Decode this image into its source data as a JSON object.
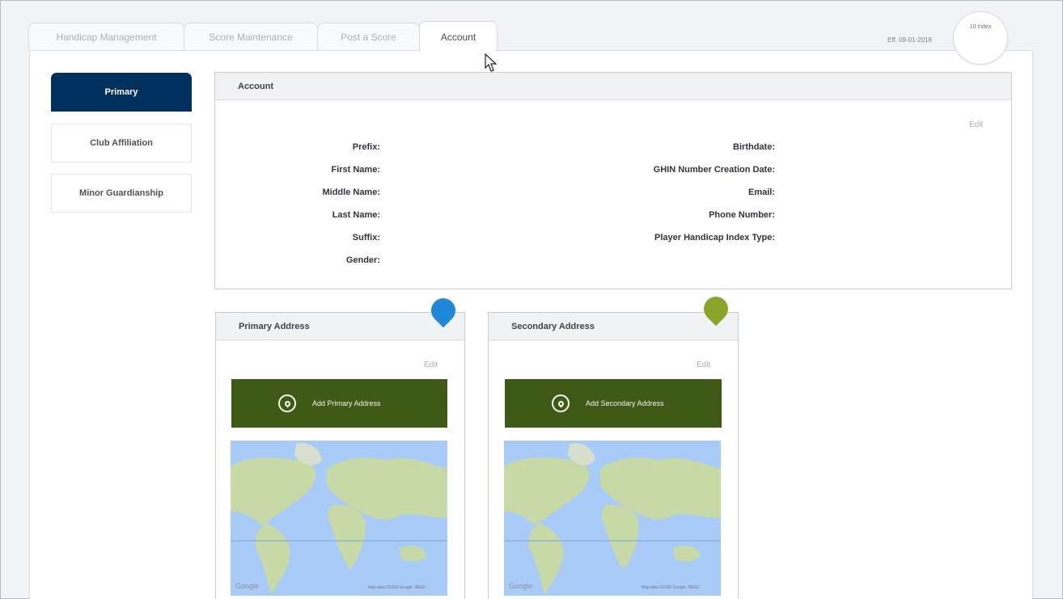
{
  "tabs": [
    {
      "label": "Handicap Management"
    },
    {
      "label": "Score Maintenance"
    },
    {
      "label": "Post a Score"
    },
    {
      "label": "Account"
    }
  ],
  "effective_date": "Eff. 09-01-2018",
  "handicap_index_label": "10 Index",
  "sidebar": {
    "items": [
      {
        "label": "Primary",
        "active": true
      },
      {
        "label": "Club Affiliation"
      },
      {
        "label": "Minor Guardianship"
      }
    ]
  },
  "account": {
    "title": "Account",
    "edit_label": "Edit",
    "left_fields": [
      "Prefix:",
      "First Name:",
      "Middle Name:",
      "Last Name:",
      "Suffix:",
      "Gender:"
    ],
    "right_fields": [
      "Birthdate:",
      "GHIN Number Creation Date:",
      "Email:",
      "Phone Number:",
      "Player Handicap Index Type:"
    ]
  },
  "primary_address": {
    "title": "Primary Address",
    "edit_label": "Edit",
    "add_label": "Add Primary Address",
    "map_logo": "Google",
    "map_attribution": "Map data ©2018 Google, INEGI",
    "marker_color": "#1f88d8"
  },
  "secondary_address": {
    "title": "Secondary Address",
    "edit_label": "Edit",
    "add_label": "Add Secondary Address",
    "map_logo": "Google",
    "map_attribution": "Map data ©2018 Google, INEGI",
    "marker_color": "#8aa52b"
  },
  "colors": {
    "primary_active": "#00305e",
    "add_button": "#3f5a17",
    "map_water": "#a9cbf7",
    "map_land": "#c7d9a7"
  }
}
